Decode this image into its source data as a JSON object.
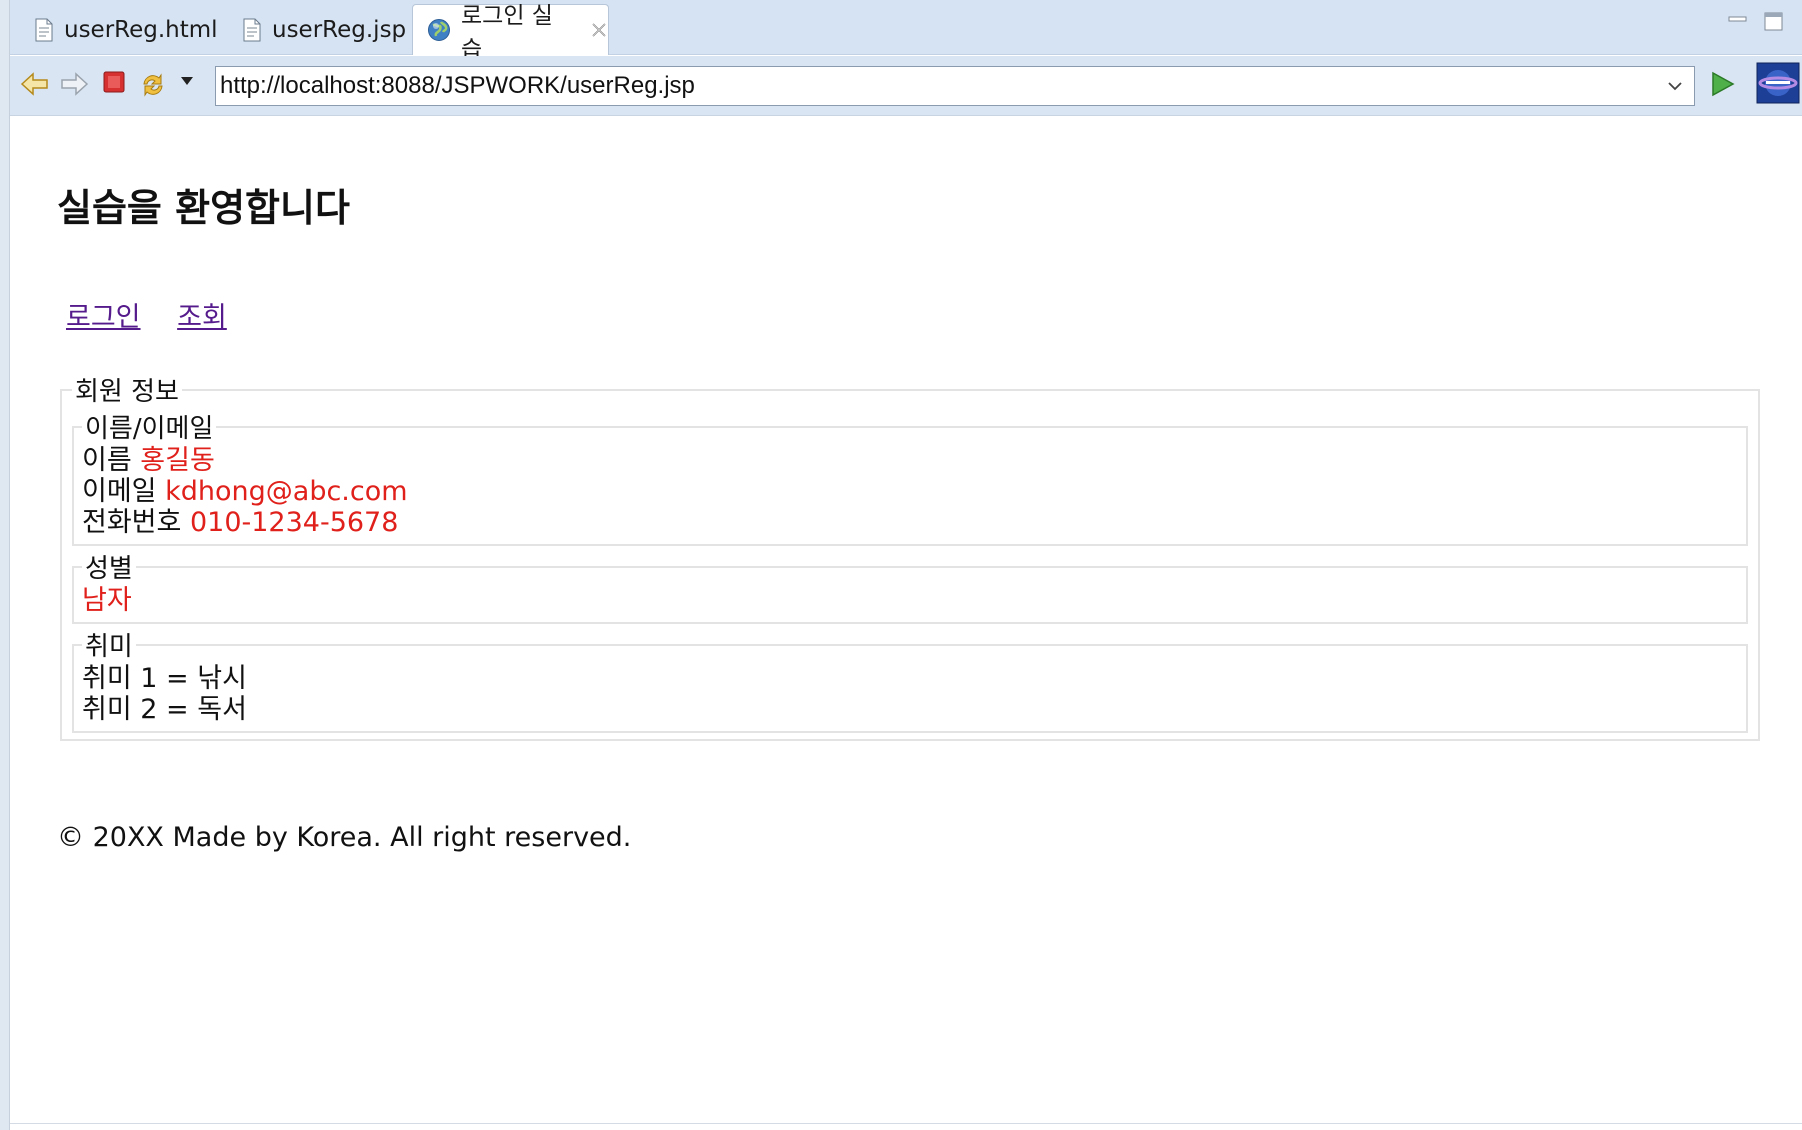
{
  "tabs": [
    {
      "label": "userReg.html",
      "icon": "html-file-icon",
      "active": false
    },
    {
      "label": "userReg.jsp",
      "icon": "jsp-file-icon",
      "active": false
    },
    {
      "label": "로그인 실습",
      "icon": "globe-icon",
      "active": true
    }
  ],
  "toolbar": {
    "url": "http://localhost:8088/JSPWORK/userReg.jsp"
  },
  "page": {
    "title": "실습을 환영합니다",
    "nav": [
      "로그인",
      "조회"
    ],
    "member_legend": "회원 정보",
    "name_email": {
      "legend": "이름/이메일",
      "name_label": "이름",
      "name_value": "홍길동",
      "email_label": "이메일",
      "email_value": "kdhong@abc.com",
      "phone_label": "전화번호",
      "phone_value": "010-1234-5678"
    },
    "gender": {
      "legend": "성별",
      "value": "남자"
    },
    "hobby": {
      "legend": "취미",
      "items": [
        "취미 1 = 낚시",
        "취미 2 = 독서"
      ]
    },
    "footer": "© 20XX Made by Korea. All right reserved."
  },
  "colors": {
    "value_red": "#e0201b",
    "visited_link": "#551a8b",
    "tab_bar": "#d6e3f2"
  }
}
